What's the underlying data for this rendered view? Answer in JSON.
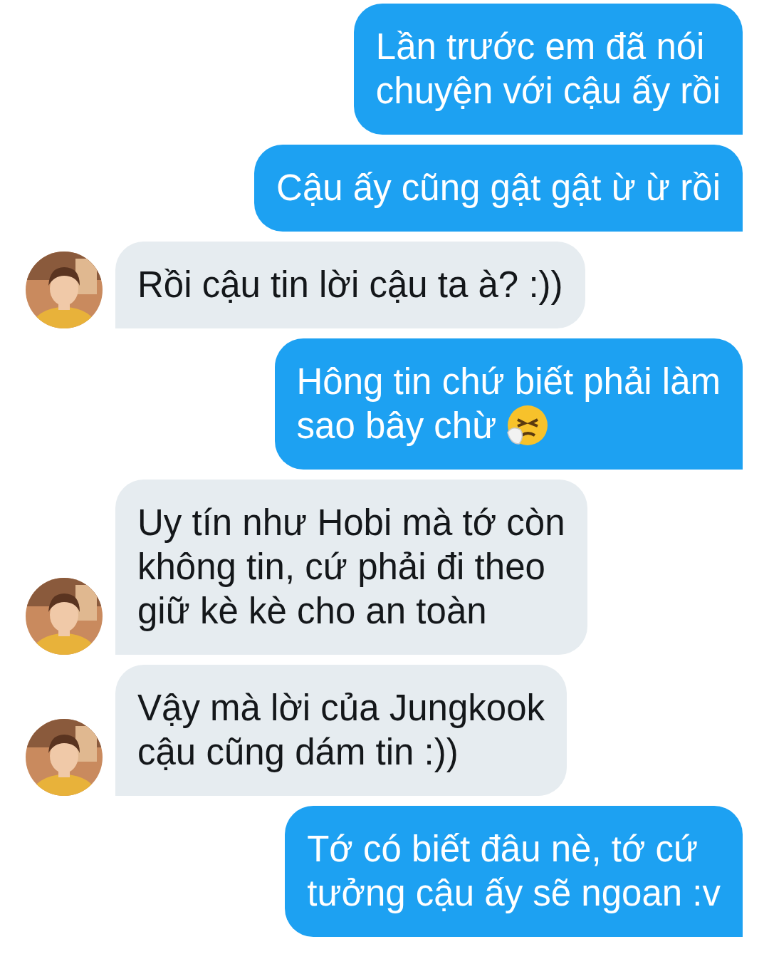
{
  "messages": [
    {
      "kind": "sent",
      "lines": [
        "Lần trước em đã nói",
        "chuyện với cậu ấy rồi"
      ]
    },
    {
      "kind": "sent",
      "lines": [
        "Cậu ấy cũng gật gật ừ ừ rồi"
      ]
    },
    {
      "kind": "received",
      "lines": [
        "Rồi cậu tin lời cậu ta à? :))"
      ]
    },
    {
      "kind": "sent",
      "lines": [
        "Hông tin chứ biết phải làm",
        "sao bây chừ"
      ],
      "trailing_emoji": true
    },
    {
      "kind": "received",
      "lines": [
        "Uy tín như Hobi mà tớ còn",
        "không tin, cứ phải đi theo",
        "giữ kè kè cho an toàn"
      ]
    },
    {
      "kind": "received",
      "lines": [
        "Vậy mà lời của Jungkook",
        "cậu cũng dám tin :))"
      ]
    },
    {
      "kind": "sent",
      "lines": [
        "Tớ có biết đâu nè, tớ cứ",
        "tưởng cậu ấy sẽ ngoan :v"
      ]
    }
  ]
}
